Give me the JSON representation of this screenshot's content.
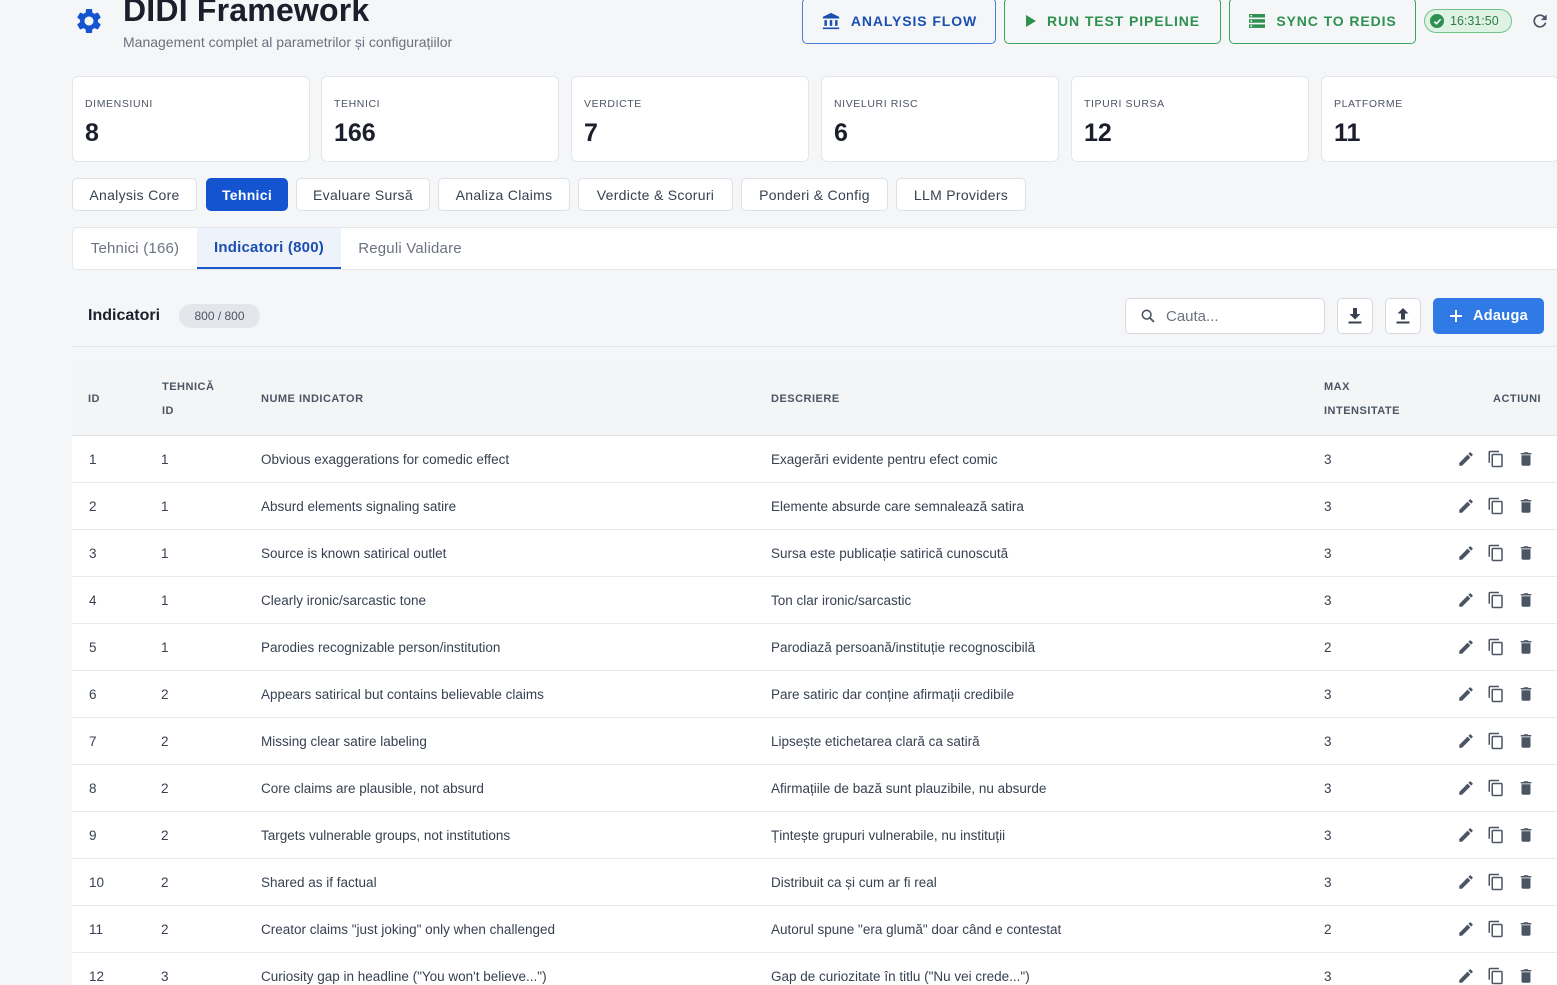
{
  "header": {
    "title": "DIDI Framework",
    "subtitle": "Management complet al parametrilor și configurațiilor",
    "buttons": {
      "analysis_flow": "ANALYSIS FLOW",
      "run_test": "RUN TEST PIPELINE",
      "sync_redis": "SYNC TO REDIS"
    },
    "clock": "16:31:50"
  },
  "stats": [
    {
      "label": "DIMENSIUNI",
      "value": "8"
    },
    {
      "label": "TEHNICI",
      "value": "166"
    },
    {
      "label": "VERDICTE",
      "value": "7"
    },
    {
      "label": "NIVELURI RISC",
      "value": "6"
    },
    {
      "label": "TIPURI SURSA",
      "value": "12"
    },
    {
      "label": "PLATFORME",
      "value": "11"
    }
  ],
  "main_tabs": [
    "Analysis Core",
    "Tehnici",
    "Evaluare Sursă",
    "Analiza Claims",
    "Verdicte & Scoruri",
    "Ponderi & Config",
    "LLM Providers"
  ],
  "active_main_tab": "Tehnici",
  "sub_tabs": [
    "Tehnici (166)",
    "Indicatori (800)",
    "Reguli Validare"
  ],
  "active_sub_tab": "Indicatori (800)",
  "toolbar": {
    "title": "Indicatori",
    "badge": "800 / 800",
    "search_placeholder": "Cauta...",
    "add_label": "Adauga"
  },
  "table": {
    "columns": {
      "id": "ID",
      "tehnica_1": "TEHNICĂ",
      "tehnica_2": "ID",
      "nume": "NUME INDICATOR",
      "descriere": "DESCRIERE",
      "max_1": "MAX",
      "max_2": "INTENSITATE",
      "actiuni": "ACTIUNI"
    },
    "rows": [
      {
        "id": "1",
        "tehnica": "1",
        "nume": "Obvious exaggerations for comedic effect",
        "descriere": "Exagerări evidente pentru efect comic",
        "max": "3"
      },
      {
        "id": "2",
        "tehnica": "1",
        "nume": "Absurd elements signaling satire",
        "descriere": "Elemente absurde care semnalează satira",
        "max": "3"
      },
      {
        "id": "3",
        "tehnica": "1",
        "nume": "Source is known satirical outlet",
        "descriere": "Sursa este publicație satirică cunoscută",
        "max": "3"
      },
      {
        "id": "4",
        "tehnica": "1",
        "nume": "Clearly ironic/sarcastic tone",
        "descriere": "Ton clar ironic/sarcastic",
        "max": "3"
      },
      {
        "id": "5",
        "tehnica": "1",
        "nume": "Parodies recognizable person/institution",
        "descriere": "Parodiază persoană/instituție recognoscibilă",
        "max": "2"
      },
      {
        "id": "6",
        "tehnica": "2",
        "nume": "Appears satirical but contains believable claims",
        "descriere": "Pare satiric dar conține afirmații credibile",
        "max": "3"
      },
      {
        "id": "7",
        "tehnica": "2",
        "nume": "Missing clear satire labeling",
        "descriere": "Lipsește etichetarea clară ca satiră",
        "max": "3"
      },
      {
        "id": "8",
        "tehnica": "2",
        "nume": "Core claims are plausible, not absurd",
        "descriere": "Afirmațiile de bază sunt plauzibile, nu absurde",
        "max": "3"
      },
      {
        "id": "9",
        "tehnica": "2",
        "nume": "Targets vulnerable groups, not institutions",
        "descriere": "Țintește grupuri vulnerabile, nu instituții",
        "max": "3"
      },
      {
        "id": "10",
        "tehnica": "2",
        "nume": "Shared as if factual",
        "descriere": "Distribuit ca și cum ar fi real",
        "max": "3"
      },
      {
        "id": "11",
        "tehnica": "2",
        "nume": "Creator claims \"just joking\" only when challenged",
        "descriere": "Autorul spune \"era glumă\" doar când e contestat",
        "max": "2"
      },
      {
        "id": "12",
        "tehnica": "3",
        "nume": "Curiosity gap in headline (\"You won't believe...\")",
        "descriere": "Gap de curiozitate în titlu (\"Nu vei crede...\")",
        "max": "3"
      }
    ]
  },
  "icons": {
    "app": "gear-icon",
    "analysis_flow": "bank-icon",
    "run_test": "play-icon",
    "sync_redis": "storage-icon",
    "clock": "check-circle-icon",
    "refresh": "refresh-icon",
    "search": "search-icon",
    "download": "download-icon",
    "upload": "upload-icon",
    "add": "plus-icon",
    "edit": "pencil-icon",
    "copy": "copy-icon",
    "delete": "trash-icon"
  },
  "colors": {
    "primary": "#1454d1",
    "add_button": "#2f7ae5",
    "success": "#2e9150"
  }
}
